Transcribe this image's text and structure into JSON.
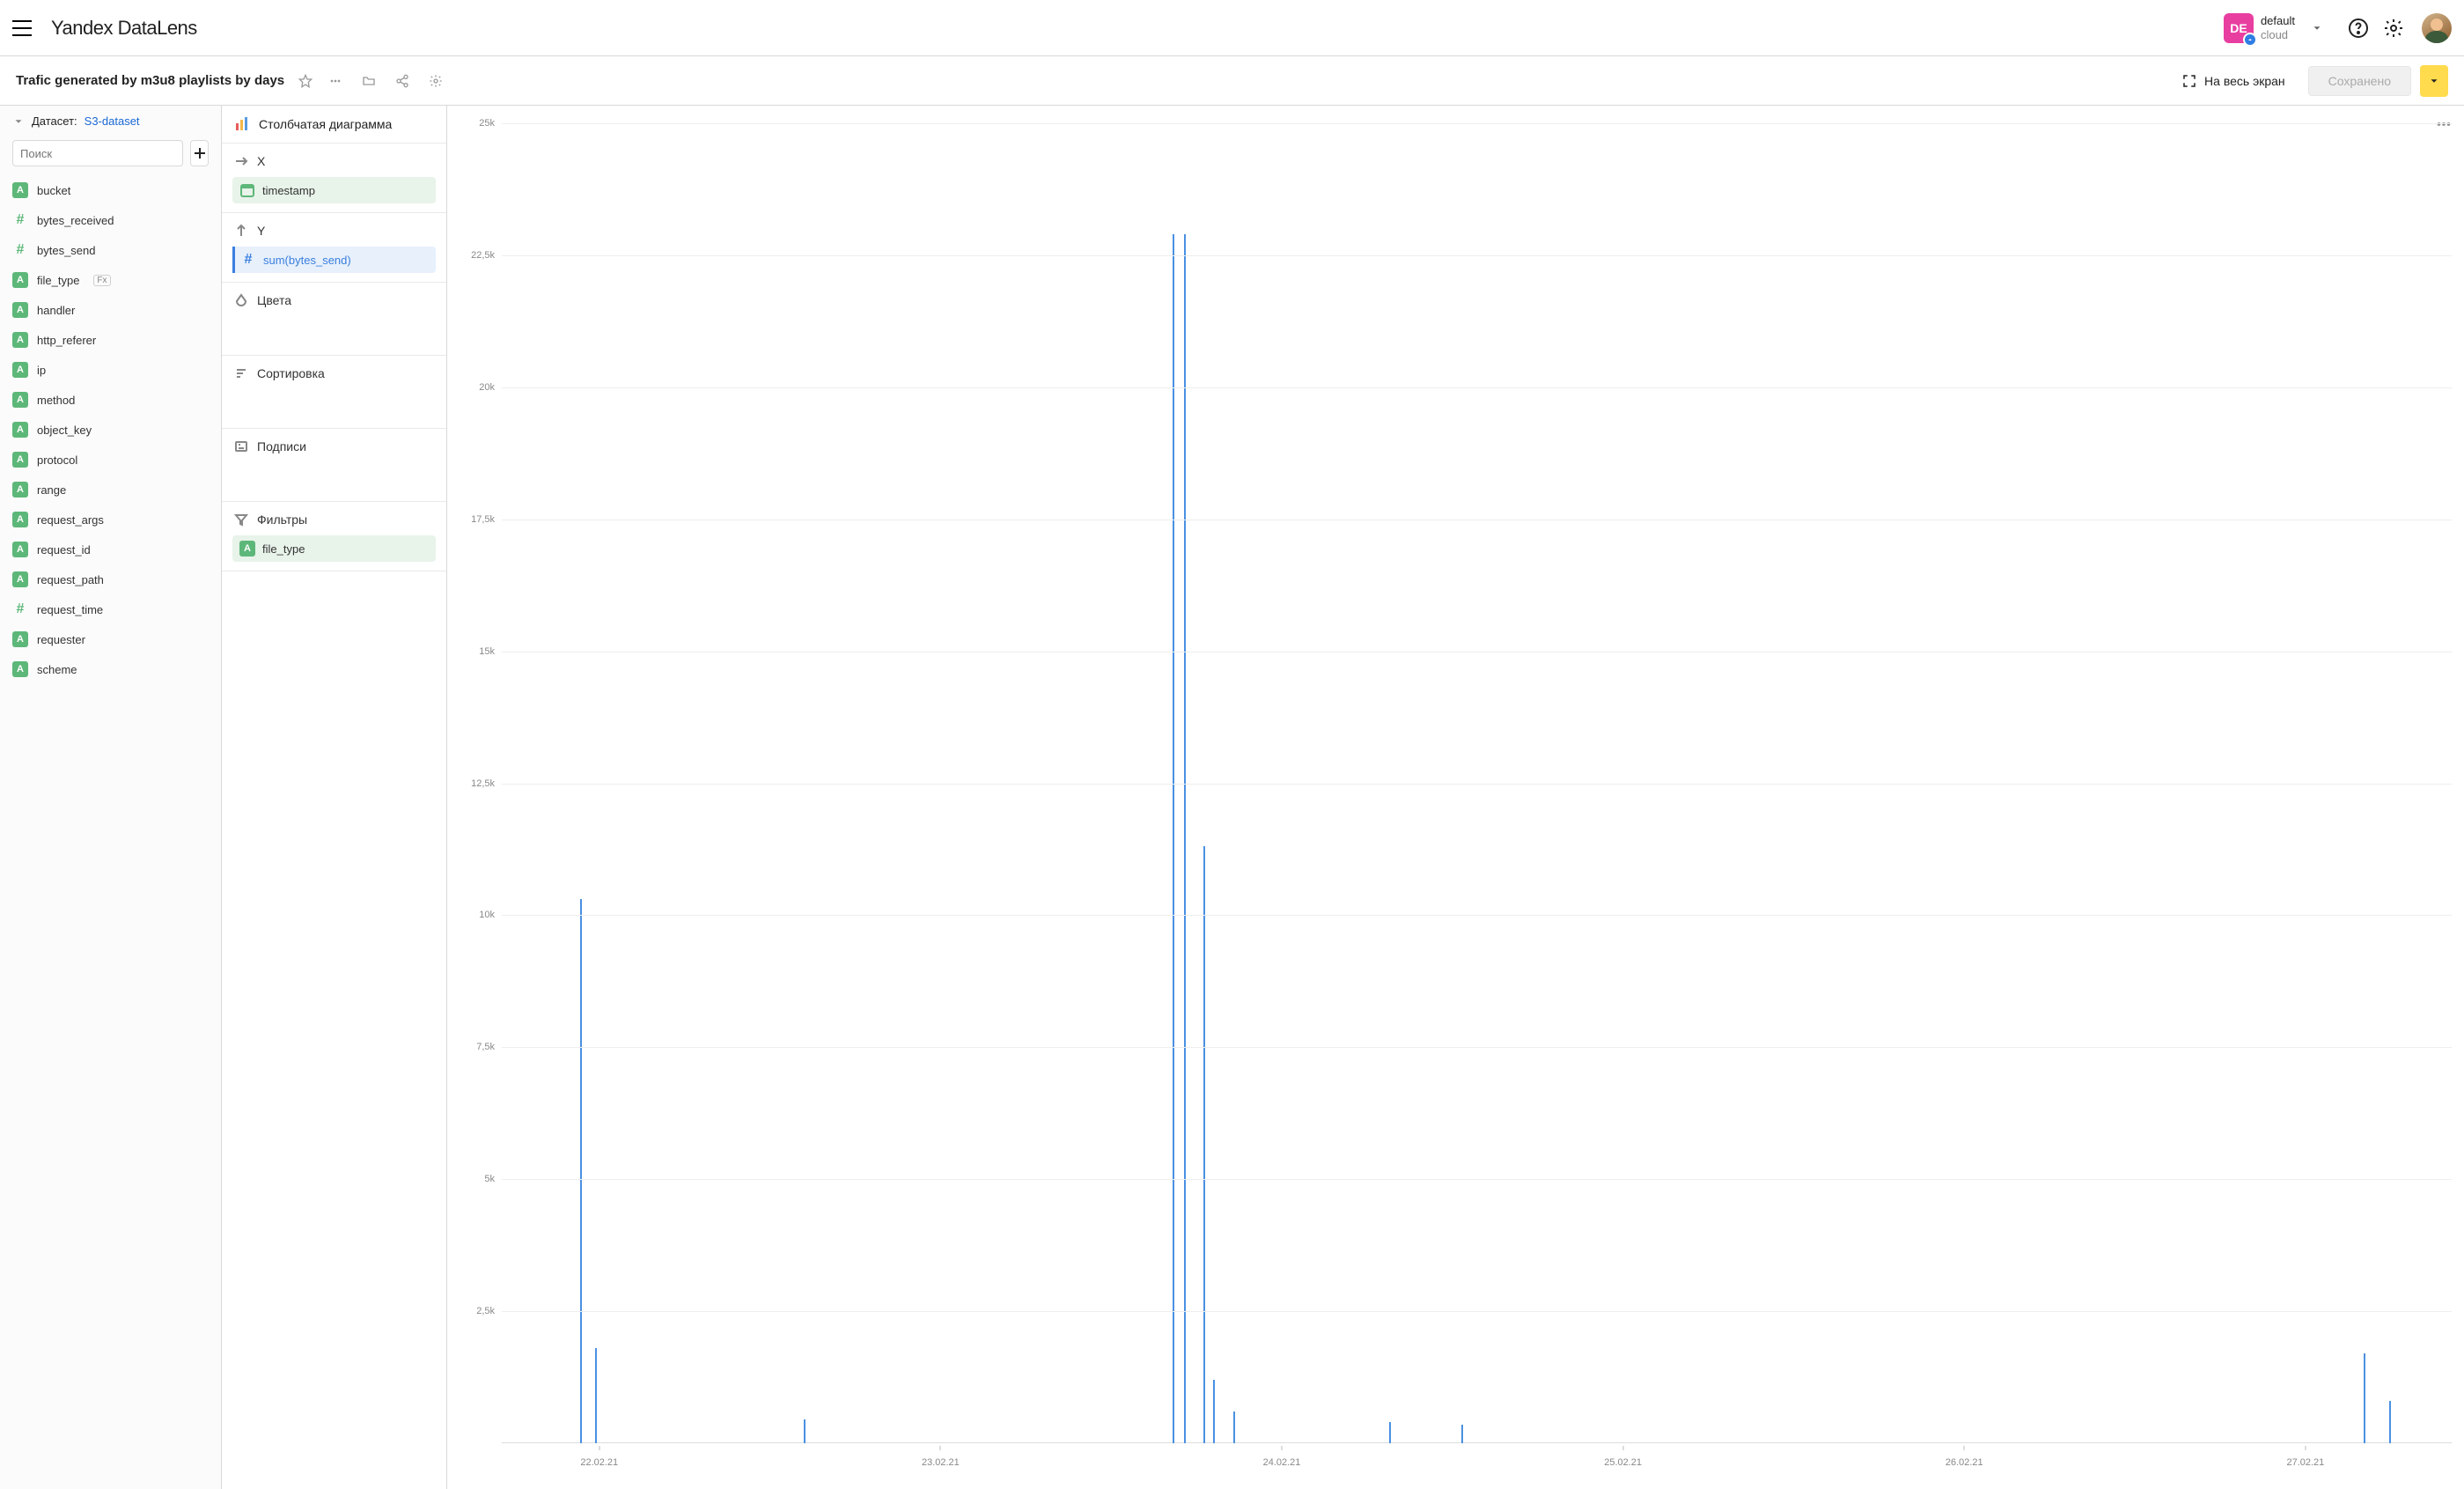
{
  "header": {
    "logo_brand": "Yandex",
    "logo_product": "DataLens",
    "cloud_badge": "DE",
    "cloud_name": "default",
    "cloud_sub": "cloud"
  },
  "titlebar": {
    "title": "Trafic generated by m3u8 playlists by days",
    "fullscreen_label": "На весь экран",
    "saved_label": "Сохранено"
  },
  "dataset": {
    "label": "Датасет:",
    "name": "S3-dataset",
    "search_placeholder": "Поиск"
  },
  "fields": [
    {
      "type": "A",
      "name": "bucket"
    },
    {
      "type": "hash",
      "name": "bytes_received"
    },
    {
      "type": "hash",
      "name": "bytes_send"
    },
    {
      "type": "A",
      "name": "file_type",
      "fx": true
    },
    {
      "type": "A",
      "name": "handler"
    },
    {
      "type": "A",
      "name": "http_referer"
    },
    {
      "type": "A",
      "name": "ip"
    },
    {
      "type": "A",
      "name": "method"
    },
    {
      "type": "A",
      "name": "object_key"
    },
    {
      "type": "A",
      "name": "protocol"
    },
    {
      "type": "A",
      "name": "range"
    },
    {
      "type": "A",
      "name": "request_args"
    },
    {
      "type": "A",
      "name": "request_id"
    },
    {
      "type": "A",
      "name": "request_path"
    },
    {
      "type": "hash",
      "name": "request_time"
    },
    {
      "type": "A",
      "name": "requester"
    },
    {
      "type": "A",
      "name": "scheme"
    }
  ],
  "config": {
    "viz_label": "Столбчатая диаграмма",
    "x_label": "X",
    "y_label": "Y",
    "colors_label": "Цвета",
    "sort_label": "Сортировка",
    "labels_label": "Подписи",
    "filters_label": "Фильтры",
    "x_chip": {
      "icon": "cal",
      "text": "timestamp"
    },
    "y_chip": {
      "icon": "hash-blue",
      "prefix": "sum(",
      "field": "bytes_send",
      "suffix": ")"
    },
    "filter_chip": {
      "icon": "A",
      "text": "file_type"
    }
  },
  "chart_data": {
    "type": "bar",
    "ylabel": "",
    "xlabel": "",
    "ylim": [
      0,
      25000
    ],
    "y_ticks": [
      "25k",
      "22,5k",
      "20k",
      "17,5k",
      "15k",
      "12,5k",
      "10k",
      "7,5k",
      "5k",
      "2,5k"
    ],
    "x_ticks": [
      {
        "label": "22.02.21",
        "pos": 0.05
      },
      {
        "label": "23.02.21",
        "pos": 0.225
      },
      {
        "label": "24.02.21",
        "pos": 0.4
      },
      {
        "label": "25.02.21",
        "pos": 0.575
      },
      {
        "label": "26.02.21",
        "pos": 0.75
      },
      {
        "label": "27.02.21",
        "pos": 0.925
      }
    ],
    "bars": [
      {
        "x": 0.04,
        "v": 10300
      },
      {
        "x": 0.048,
        "v": 1800
      },
      {
        "x": 0.155,
        "v": 450
      },
      {
        "x": 0.344,
        "v": 22900
      },
      {
        "x": 0.35,
        "v": 22900
      },
      {
        "x": 0.36,
        "v": 11300
      },
      {
        "x": 0.365,
        "v": 1200
      },
      {
        "x": 0.375,
        "v": 600
      },
      {
        "x": 0.455,
        "v": 400
      },
      {
        "x": 0.492,
        "v": 350
      },
      {
        "x": 0.955,
        "v": 1700
      },
      {
        "x": 0.968,
        "v": 800
      }
    ]
  }
}
